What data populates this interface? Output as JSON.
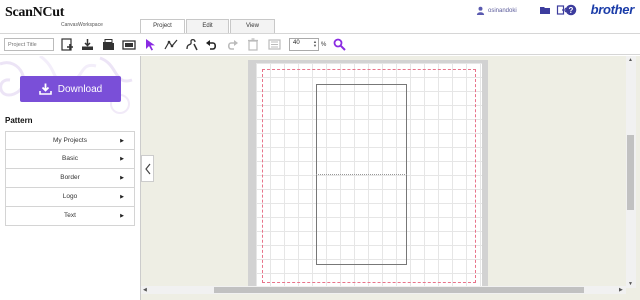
{
  "header": {
    "logo_main": "ScanNCut",
    "logo_sub": "CanvasWorkspace",
    "tabs": [
      {
        "label": "Project"
      },
      {
        "label": "Edit"
      },
      {
        "label": "View"
      }
    ],
    "username": "osinandoki",
    "brand": "brother",
    "brand_color": "#1a3ca8"
  },
  "toolbar": {
    "title_placeholder": "Project Title",
    "zoom_value": "40",
    "zoom_unit": "%",
    "accent_color": "#8a2be2",
    "icons": [
      "new-project-icon",
      "import-icon",
      "open-folder-icon",
      "scan-icon",
      "select-arrow-icon",
      "node-edit-icon",
      "freehand-icon",
      "undo-icon",
      "redo-icon",
      "delete-icon",
      "fit-icon",
      "zoom-search-icon"
    ]
  },
  "sidebar": {
    "download_label": "Download",
    "download_color": "#7a4fd8",
    "pattern_heading": "Pattern",
    "items": [
      {
        "label": "My Projects"
      },
      {
        "label": "Basic"
      },
      {
        "label": "Border"
      },
      {
        "label": "Logo"
      },
      {
        "label": "Text"
      }
    ]
  }
}
